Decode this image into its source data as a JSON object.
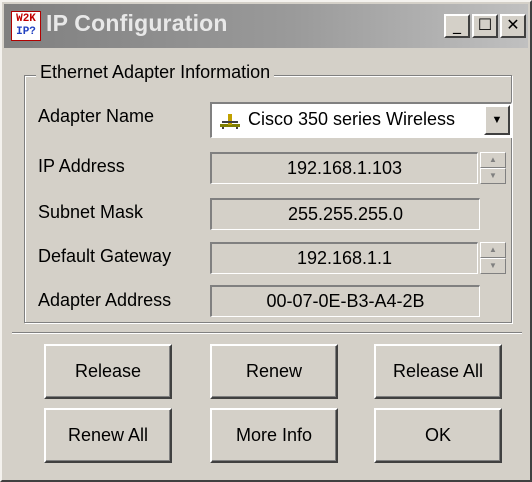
{
  "window": {
    "title": "IP Configuration",
    "icon_line1": "W2K",
    "icon_line2": "IP?",
    "minimize_glyph": "_",
    "maximize_glyph": "☐",
    "close_glyph": "✕"
  },
  "group": {
    "label": "Ethernet Adapter Information"
  },
  "fields": {
    "adapter_name_label": "Adapter Name",
    "adapter_name_value": "Cisco 350 series Wireless",
    "ip_address_label": "IP Address",
    "ip_address_value": "192.168.1.103",
    "subnet_mask_label": "Subnet Mask",
    "subnet_mask_value": "255.255.255.0",
    "default_gateway_label": "Default Gateway",
    "default_gateway_value": "192.168.1.1",
    "adapter_address_label": "Adapter Address",
    "adapter_address_value": "00-07-0E-B3-A4-2B"
  },
  "buttons": {
    "release": "Release",
    "renew": "Renew",
    "release_all": "Release All",
    "renew_all": "Renew All",
    "more_info": "More Info",
    "ok": "OK"
  },
  "icons": {
    "app": "w2k-ip-app-icon",
    "adapter": "network-adapter-icon",
    "dropdown": "chevron-down-icon",
    "spin_up": "spin-up-icon",
    "spin_down": "spin-down-icon"
  }
}
